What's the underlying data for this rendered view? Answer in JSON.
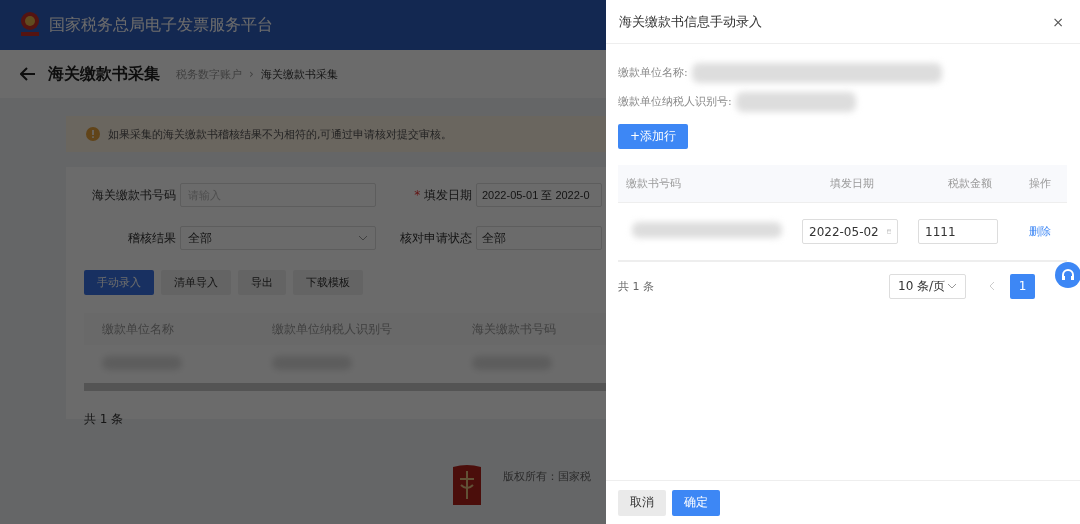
{
  "header": {
    "title": "国家税务总局电子发票服务平台"
  },
  "page": {
    "title": "海关缴款书采集",
    "separator": "›",
    "breadcrumb": [
      {
        "label": "税务数字账户",
        "current": false
      },
      {
        "label": "海关缴款书采集",
        "current": true
      }
    ]
  },
  "notice": "如果采集的海关缴款书稽核结果不为相符的,可通过申请核对提交审核。",
  "filters": [
    {
      "label": "海关缴款书号码",
      "kind": "text",
      "placeholder": "请输入"
    },
    {
      "label": "填发日期",
      "kind": "text",
      "required_mark": "*",
      "value": "2022-05-01 至 2022-0"
    },
    {
      "label": "稽核结果",
      "kind": "select",
      "value": "全部"
    },
    {
      "label": "核对申请状态",
      "kind": "text",
      "value": "全部"
    }
  ],
  "actions": [
    {
      "label": "手动录入",
      "primary": true
    },
    {
      "label": "清单导入",
      "primary": false
    },
    {
      "label": "导出",
      "primary": false
    },
    {
      "label": "下载模板",
      "primary": false
    }
  ],
  "table": {
    "columns": [
      "缴款单位名称",
      "缴款单位纳税人识别号",
      "海关缴款书号码"
    ],
    "rows": [
      {
        "cells": [
          {
            "redacted": true
          },
          {
            "redacted": true
          },
          {
            "redacted": true
          }
        ]
      }
    ]
  },
  "total": "共 1 条",
  "footer": {
    "text": "版权所有：国家税"
  },
  "drawer": {
    "title": "海关缴款书信息手动录入",
    "close": "×",
    "fields": [
      {
        "label": "缴款单位名称:",
        "redacted": true
      },
      {
        "label": "缴款单位纳税人识别号:",
        "redacted": true
      }
    ],
    "add_button": "+添加行",
    "columns": [
      "缴款书号码",
      "填发日期",
      "税款金额",
      "操作"
    ],
    "rows": [
      {
        "number_redacted": true,
        "date": "2022-05-02",
        "amount": "1111",
        "action": "删除"
      }
    ],
    "total": "共 1 条",
    "page_size": "10 条/页",
    "pages": [
      {
        "label": "1",
        "selected": true
      }
    ],
    "buttons": [
      {
        "label": "取消",
        "primary": false
      },
      {
        "label": "确定",
        "primary": true
      }
    ]
  }
}
